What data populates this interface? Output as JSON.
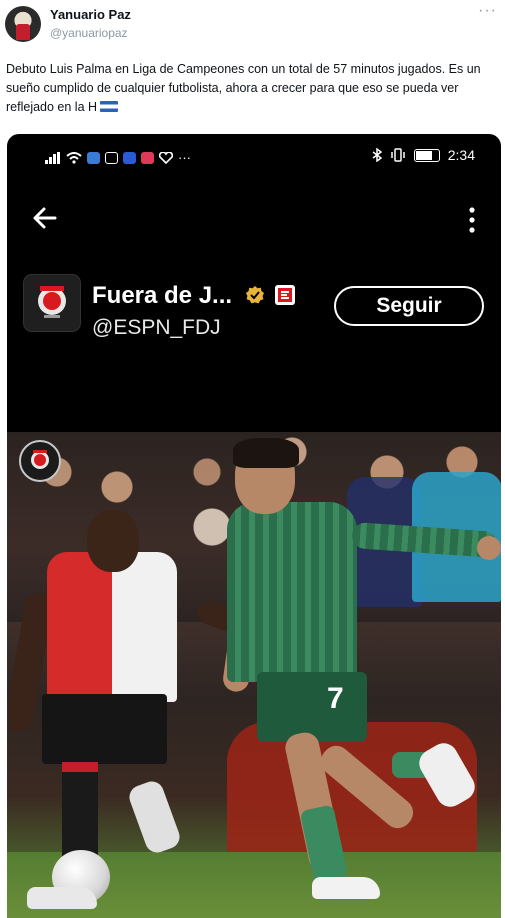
{
  "tweet": {
    "author_name": "Yanuario Paz",
    "author_handle": "@yanuariopaz",
    "more_glyph": "···",
    "text": "Debuto Luis Palma en Liga de Campeones con un total de 57 minutos jugados. Es un sueño cumplido de cualquier futbolista, ahora a crecer para que eso se pueda ver reflejado en la H"
  },
  "embedded_screenshot": {
    "status_bar": {
      "time": "2:34"
    },
    "profile": {
      "name": "Fuera de J...",
      "handle": "@ESPN_FDJ",
      "follow_label": "Seguir"
    },
    "photo": {
      "player_number": "7"
    }
  },
  "colors": {
    "accent_border": "#ffffff",
    "verified_badge": "#e8b43a",
    "espn_red": "#d71920"
  }
}
